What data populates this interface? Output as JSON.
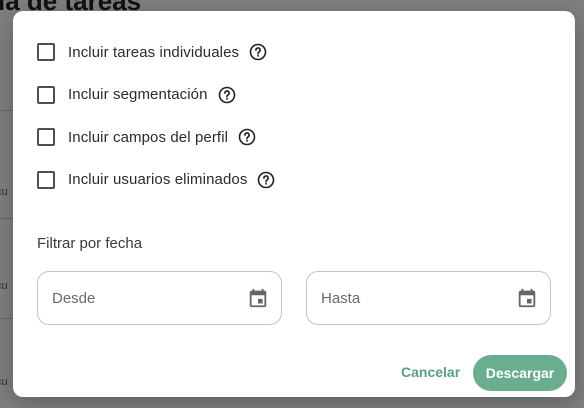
{
  "background": {
    "page_title": "ia de tareas",
    "row_snippets": [
      "cu",
      "cu",
      "cu"
    ]
  },
  "dialog": {
    "options": [
      {
        "label": "Incluir tareas individuales",
        "checked": false
      },
      {
        "label": "Incluir segmentación",
        "checked": false
      },
      {
        "label": "Incluir campos del perfil",
        "checked": false
      },
      {
        "label": "Incluir usuarios eliminados",
        "checked": false
      }
    ],
    "filter_label": "Filtrar por fecha",
    "date_from_placeholder": "Desde",
    "date_to_placeholder": "Hasta",
    "cancel_label": "Cancelar",
    "download_label": "Descargar"
  },
  "colors": {
    "accent": "#6aad8f",
    "accent_text": "#5a9e83",
    "overlay": "#000000"
  },
  "icons": {
    "help": "help-circle-icon",
    "calendar": "calendar-icon"
  }
}
